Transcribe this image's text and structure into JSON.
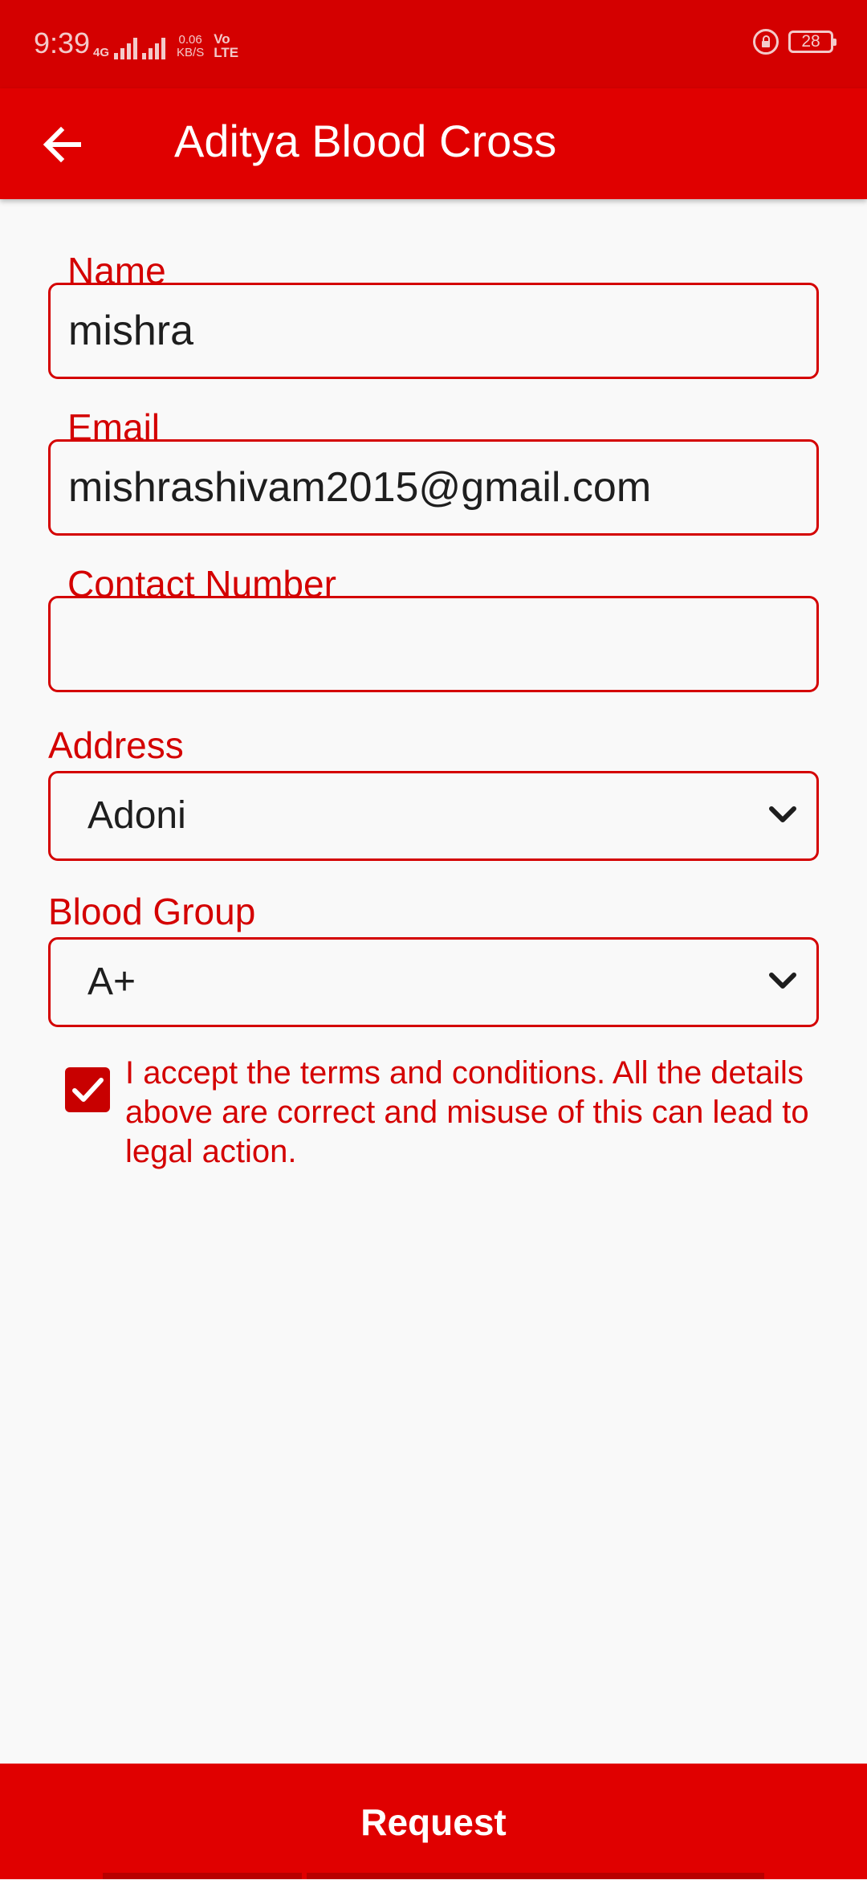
{
  "status_bar": {
    "time": "9:39",
    "network_type": "4G",
    "data_speed_value": "0.06",
    "data_speed_unit": "KB/S",
    "volte_top": "Vo",
    "volte_bottom": "LTE",
    "battery": "28"
  },
  "app_bar": {
    "title": "Aditya Blood Cross"
  },
  "form": {
    "name_label": "Name",
    "name_value": "mishra",
    "email_label": "Email",
    "email_value": "mishrashivam2015@gmail.com",
    "contact_label": "Contact Number",
    "contact_value": "",
    "address_label": "Address",
    "address_value": "Adoni",
    "blood_group_label": "Blood Group",
    "blood_group_value": "A+",
    "terms_checked": true,
    "terms_text": "I accept the terms and conditions. All the details above are correct and misuse of this can lead to legal action."
  },
  "actions": {
    "request_label": "Request"
  },
  "colors": {
    "primary_red": "#e00000",
    "status_red": "#d40000",
    "background": "#f9f9f9",
    "text_dark": "#1e1e1e"
  },
  "icons": {
    "back": "arrow-left-icon",
    "dropdown": "chevron-down-icon",
    "checkbox": "check-icon",
    "lock": "lock-rotation-icon",
    "battery": "battery-icon",
    "signal": "signal-icon"
  }
}
